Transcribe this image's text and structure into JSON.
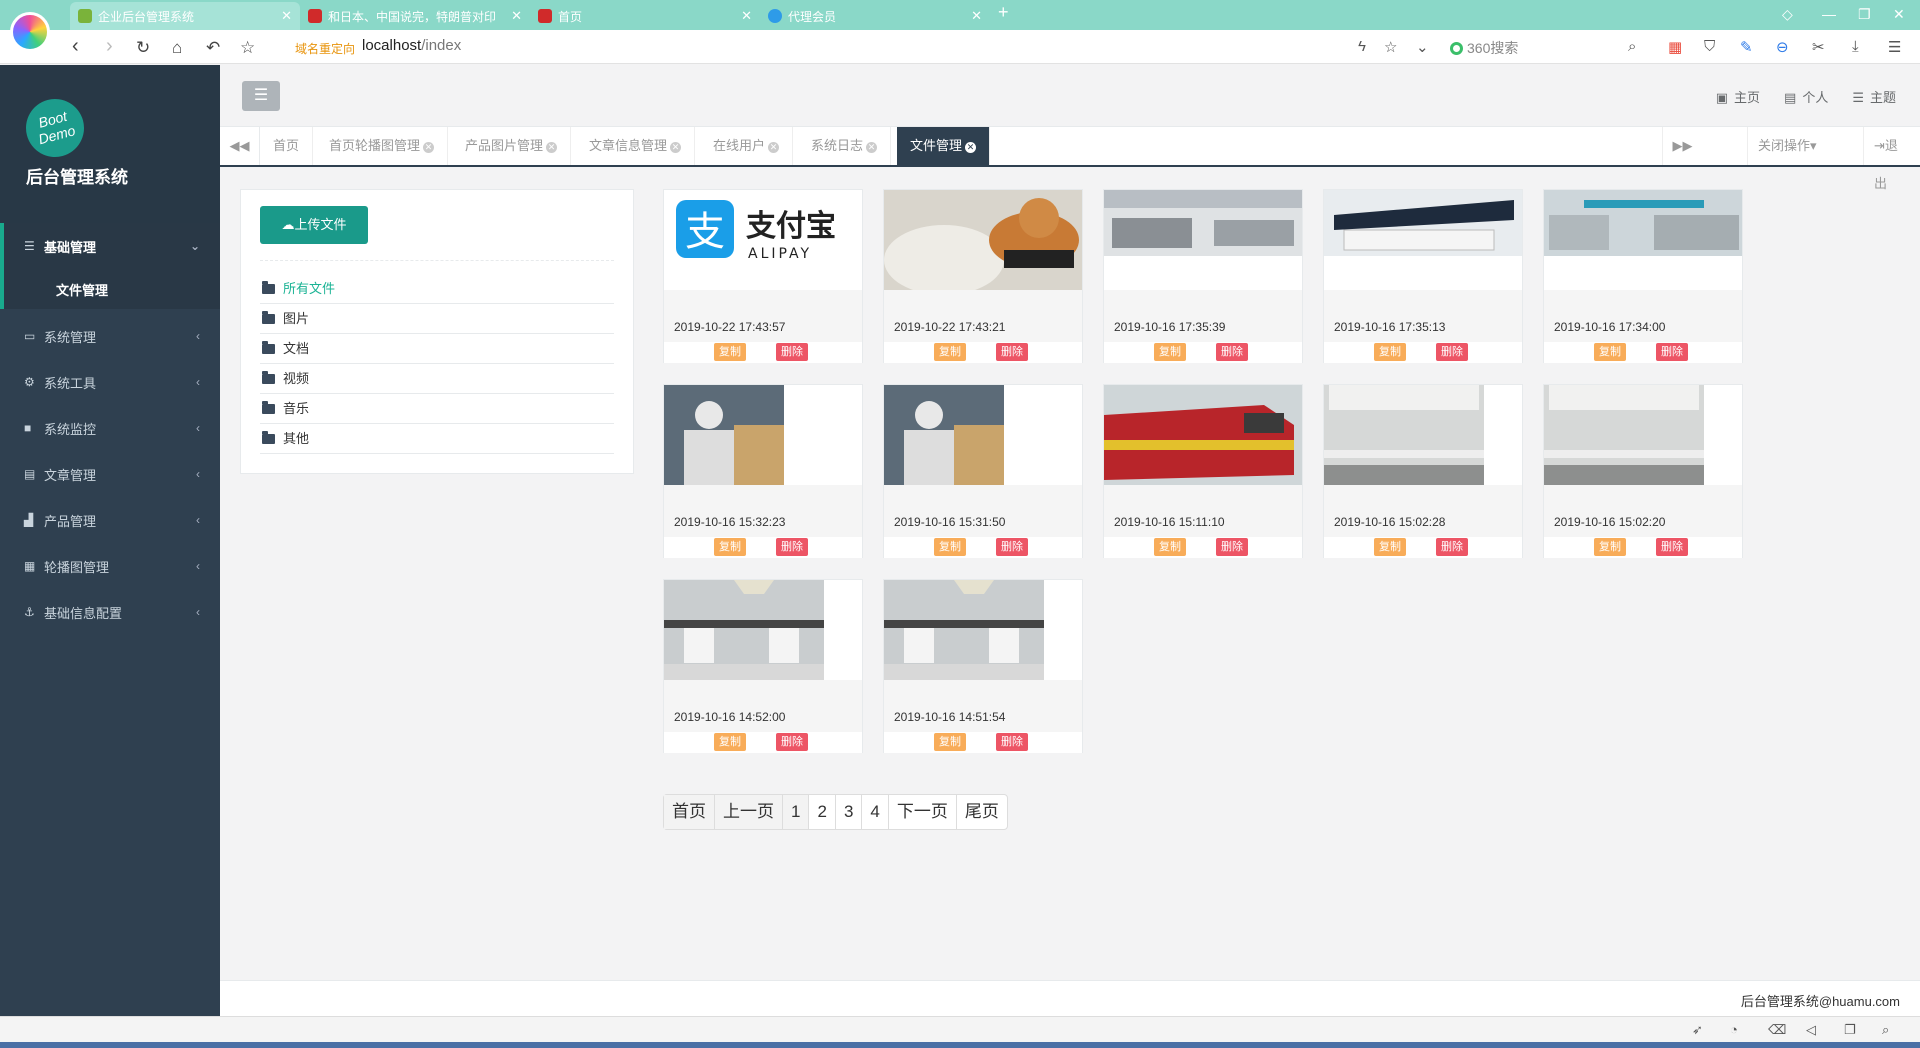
{
  "browser": {
    "tabs": [
      {
        "label": "企业后台管理系统",
        "fav": "#7ab33a"
      },
      {
        "label": "和日本、中国说完，特朗普对印",
        "fav": "#d02a2a"
      },
      {
        "label": "首页",
        "fav": "#d02a2a"
      },
      {
        "label": "代理会员",
        "fav": "#2e9be8"
      }
    ],
    "new_tab": "+",
    "redirect_label": "域名重定向",
    "url_host": "localhost",
    "url_path": "/index",
    "search_placeholder": "360搜索"
  },
  "app": {
    "logo_text_1": "Boot",
    "logo_text_2": "Demo",
    "title": "后台管理系统"
  },
  "sidebar": {
    "open_item": "基础管理",
    "sub_item": "文件管理",
    "items": [
      {
        "label": "系统管理",
        "icon": "monitor-icon",
        "glyph": "▭"
      },
      {
        "label": "系统工具",
        "icon": "gear-icon",
        "glyph": "⚙"
      },
      {
        "label": "系统监控",
        "icon": "video-icon",
        "glyph": "■"
      },
      {
        "label": "文章管理",
        "icon": "id-card-icon",
        "glyph": "▤"
      },
      {
        "label": "产品管理",
        "icon": "chart-icon",
        "glyph": "▟"
      },
      {
        "label": "轮播图管理",
        "icon": "calendar-icon",
        "glyph": "▦"
      },
      {
        "label": "基础信息配置",
        "icon": "anchor-icon",
        "glyph": "⚓"
      }
    ]
  },
  "topbar": {
    "links": [
      {
        "label": "主页",
        "glyph": "▣"
      },
      {
        "label": "个人",
        "glyph": "▤"
      },
      {
        "label": "主题",
        "glyph": "☰"
      }
    ]
  },
  "pagetabs": {
    "tabs": [
      "首页",
      "首页轮播图管理",
      "产品图片管理",
      "文章信息管理",
      "在线用户",
      "系统日志",
      "文件管理"
    ],
    "close_ops": "关闭操作▾",
    "logout": "退出"
  },
  "folders": {
    "upload": "上传文件",
    "items": [
      "所有文件",
      "图片",
      "文档",
      "视频",
      "音乐",
      "其他"
    ]
  },
  "files": {
    "copy_label": "复制",
    "delete_label": "删除",
    "items": [
      {
        "date": "2019-10-22 17:43:57",
        "kind": "alipay"
      },
      {
        "date": "2019-10-22 17:43:21",
        "kind": "dog"
      },
      {
        "date": "2019-10-16 17:35:39",
        "kind": "lab1"
      },
      {
        "date": "2019-10-16 17:35:13",
        "kind": "lab2"
      },
      {
        "date": "2019-10-16 17:34:00",
        "kind": "lab3"
      },
      {
        "date": "2019-10-16 15:32:23",
        "kind": "worker"
      },
      {
        "date": "2019-10-16 15:31:50",
        "kind": "worker"
      },
      {
        "date": "2019-10-16 15:11:10",
        "kind": "train"
      },
      {
        "date": "2019-10-16 15:02:28",
        "kind": "shelf"
      },
      {
        "date": "2019-10-16 15:02:20",
        "kind": "shelf"
      },
      {
        "date": "2019-10-16 14:52:00",
        "kind": "desk"
      },
      {
        "date": "2019-10-16 14:51:54",
        "kind": "desk"
      }
    ]
  },
  "pager": [
    "首页",
    "上一页",
    "1",
    "2",
    "3",
    "4",
    "下一页",
    "尾页"
  ],
  "footer": "后台管理系统@huamu.com"
}
